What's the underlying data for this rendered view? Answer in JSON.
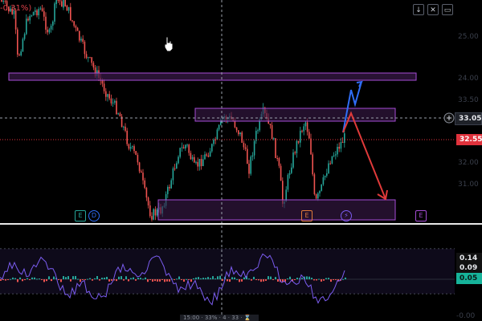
{
  "header": {
    "change_text": "-0.31%)"
  },
  "toolbar": {
    "down_label": "↓",
    "close_label": "✕",
    "expand_label": "▭"
  },
  "price_axis": {
    "ticks": [
      "25.00",
      "24.00",
      "33.50",
      "33.00",
      "32.00",
      "31.00"
    ],
    "crosshair_price": "33.05",
    "last_price": "32.55"
  },
  "indicator_axis": {
    "ticks": [
      "0.14",
      "0.09",
      "0.05"
    ],
    "bottom_tick": "-0.00"
  },
  "events": {
    "earnings_left": "E",
    "dividend_left": "D",
    "earnings_mid": "E",
    "flash": "⚡",
    "earnings_right": "E"
  },
  "bottom_bar": {
    "text": "15:00 · 33% · 4 · 33 · ⌛"
  },
  "colors": {
    "background": "#000000",
    "candle_up": "#26a69a",
    "candle_down": "#ef5350",
    "zone_fill": "#3a1a4a",
    "zone_stroke": "#a64dd6",
    "arrow_up": "#2f6df6",
    "arrow_down": "#e03a3a",
    "last_price_tag": "#e0323c",
    "indicator_tag": "#16b39a",
    "oscillator_line": "#7b5cf0"
  }
}
